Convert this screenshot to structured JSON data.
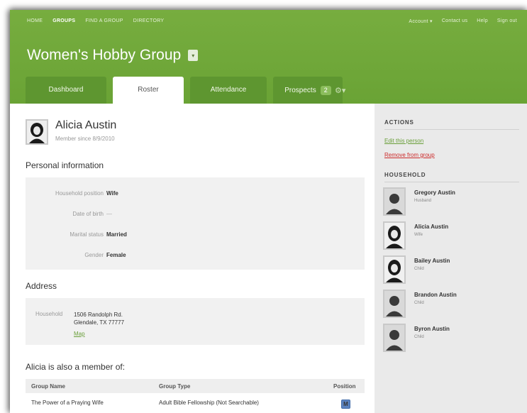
{
  "topnav": {
    "left": [
      "HOME",
      "GROUPS",
      "FIND A GROUP",
      "DIRECTORY"
    ],
    "active_index": 1,
    "account": "Account ▾",
    "contact": "Contact us",
    "help": "Help",
    "signout": "Sign out"
  },
  "group": {
    "title": "Women's Hobby Group",
    "dropdown_icon": "chevron-down-icon"
  },
  "tabs": [
    {
      "label": "Dashboard"
    },
    {
      "label": "Roster",
      "active": true
    },
    {
      "label": "Attendance"
    },
    {
      "label": "Prospects",
      "badge": "2"
    }
  ],
  "settings_icon": "gear-icon",
  "person": {
    "name": "Alicia Austin",
    "member_since": "Member since 8/9/2010",
    "avatar_icon": "person-silhouette-icon"
  },
  "personal": {
    "heading": "Personal information",
    "fields": [
      {
        "label": "Household position",
        "value": "Wife"
      },
      {
        "label": "Date of birth",
        "value": "—"
      },
      {
        "label": "Marital status",
        "value": "Married"
      },
      {
        "label": "Gender",
        "value": "Female"
      }
    ]
  },
  "address": {
    "heading": "Address",
    "label": "Household",
    "line1": "1506 Randolph Rd.",
    "line2": "Glendale, TX 77777",
    "map_link": "Map"
  },
  "memberships": {
    "heading": "Alicia is also a member of:",
    "columns": [
      "Group Name",
      "Group Type",
      "Position"
    ],
    "rows": [
      {
        "name": "The Power of a Praying Wife",
        "type": "Adult Bible Fellowship (Not Searchable)",
        "position": "M"
      }
    ]
  },
  "sidebar": {
    "actions_heading": "ACTIONS",
    "edit_link": "Edit this person",
    "remove_link": "Remove from group",
    "household_heading": "HOUSEHOLD",
    "household": [
      {
        "name": "Gregory Austin",
        "role": "Husband"
      },
      {
        "name": "Alicia Austin",
        "role": "Wife"
      },
      {
        "name": "Bailey Austin",
        "role": "Child"
      },
      {
        "name": "Brandon Austin",
        "role": "Child"
      },
      {
        "name": "Byron Austin",
        "role": "Child"
      }
    ]
  },
  "colors": {
    "brand_green": "#6aa335",
    "link_green": "#6a9f3a",
    "danger_red": "#cc2a2a",
    "badge_blue": "#5b83c0"
  }
}
